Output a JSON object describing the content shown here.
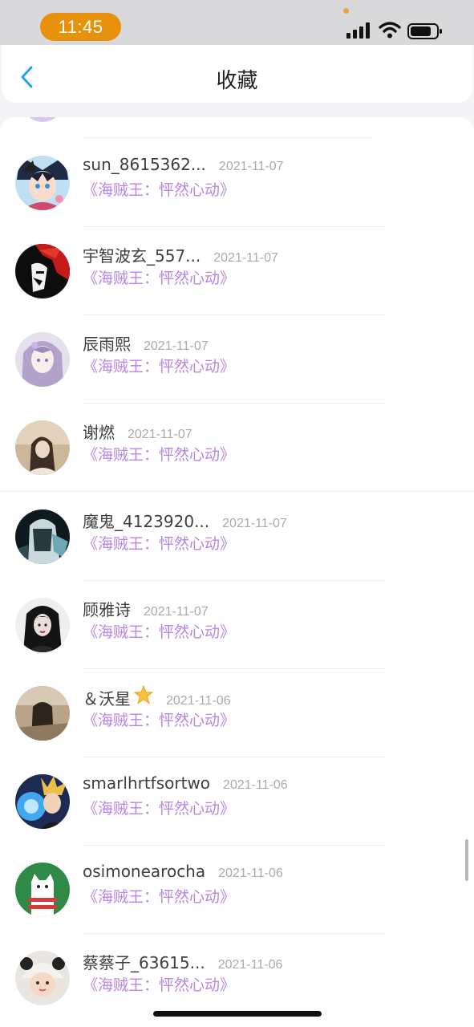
{
  "status_bar": {
    "time": "11:45",
    "accent_color": "#e8910d"
  },
  "header": {
    "back_icon": "chevron-left-icon",
    "title": "收藏"
  },
  "favorites": [
    {
      "name": "sun_8615362...",
      "date": "2021-11-07",
      "book": "《海贼王：怦然心动》",
      "avatar": "anime-boy"
    },
    {
      "name": "宇智波玄_557...",
      "date": "2021-11-07",
      "book": "《海贼王：怦然心动》",
      "avatar": "red-hair-character"
    },
    {
      "name": "辰雨熙",
      "date": "2021-11-07",
      "book": "《海贼王：怦然心动》",
      "avatar": "purple-hair-girl"
    },
    {
      "name": "谢燃",
      "date": "2021-11-07",
      "book": "《海贼王：怦然心动》",
      "avatar": "girl-photo"
    },
    {
      "name": "魔鬼_4123920...",
      "date": "2021-11-07",
      "book": "《海贼王：怦然心动》",
      "avatar": "dark-character"
    },
    {
      "name": "顾雅诗",
      "date": "2021-11-07",
      "book": "《海贼王：怦然心动》",
      "avatar": "dark-hair-girl"
    },
    {
      "name": "＆沃星",
      "date": "2021-11-06",
      "book": "《海贼王：怦然心动》",
      "avatar": "girl-silhouette",
      "emoji": "star-icon"
    },
    {
      "name": "smarlhrtfsortwo",
      "date": "2021-11-06",
      "book": "《海贼王：怦然心动》",
      "avatar": "anime-blue-energy"
    },
    {
      "name": "osimonearocha",
      "date": "2021-11-06",
      "book": "《海贼王：怦然心动》",
      "avatar": "cartoon-cat"
    },
    {
      "name": "蔡蔡子_63615...",
      "date": "2021-11-06",
      "book": "《海贼王：怦然心动》",
      "avatar": "baby-panda-hat"
    }
  ],
  "colors": {
    "book_title": "#b785e6",
    "date": "#aaaaaa",
    "name": "#3e3e3e",
    "back_icon": "#2aa0e8"
  }
}
